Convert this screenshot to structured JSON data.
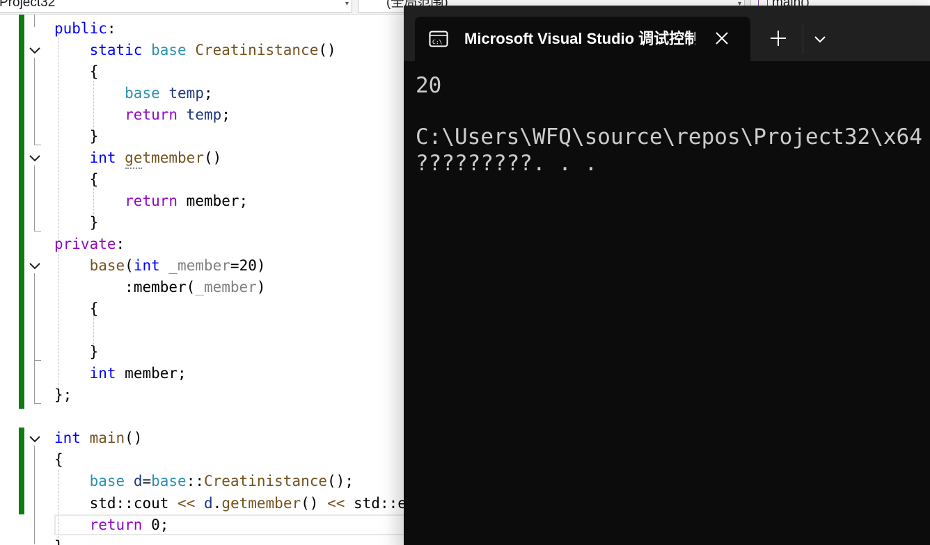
{
  "navbar": {
    "project": "Project32",
    "scope": "(全局范围)",
    "member": "main()"
  },
  "code": {
    "public_kw": "public",
    "colon": ":",
    "static_kw": "static",
    "base_type": "base",
    "creat_fn": "Creatinistance",
    "parens": "()",
    "brace_open": "{",
    "brace_close": "}",
    "temp_var": "temp",
    "semicolon": ";",
    "return_kw": "return",
    "int_kw": "int",
    "getmember_fn": "getmember",
    "member_var": "member",
    "private_kw": "private",
    "ctor_name": "base",
    "paren_open": "(",
    "paren_close": ")",
    "param_name": "_member",
    "equals": "=",
    "twenty": "20",
    "init_colon": ":",
    "class_end": "};",
    "main_fn": "main",
    "d_var": "d",
    "scope_op": "::",
    "std_ns": "std",
    "cout_obj": "cout",
    "shift_op": "<<",
    "dot": ".",
    "std_e_partial": "std::e",
    "zero": "0"
  },
  "terminal": {
    "tab_title": "Microsoft Visual Studio 调试控制台",
    "tab_icon": "terminal-cmd-icon",
    "close_icon": "close-icon",
    "new_tab_icon": "plus-icon",
    "dropdown_icon": "chevron-down-icon",
    "output": [
      "20",
      "",
      "C:\\Users\\WFQ\\source\\repos\\Project32\\x64",
      "?????????. . ."
    ]
  },
  "colors": {
    "keyword": "#0000ff",
    "control": "#8f08c4",
    "type": "#2b91af",
    "function": "#74531f",
    "variable": "#1f377f",
    "parameter": "#808080",
    "number": "#098658",
    "change_bar": "#107c10",
    "terminal_bg": "#0c0c0c",
    "terminal_text": "#cccccc"
  }
}
